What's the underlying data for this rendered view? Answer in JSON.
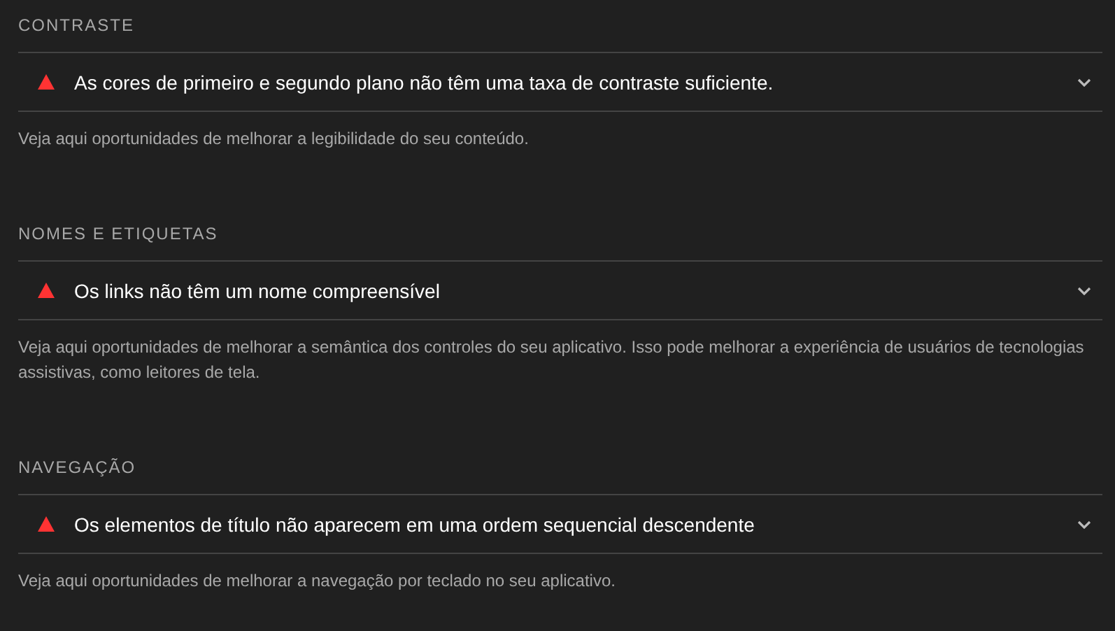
{
  "sections": [
    {
      "title": "CONTRASTE",
      "audit": {
        "text": "As cores de primeiro e segundo plano não têm uma taxa de contraste suficiente.",
        "expanded": false
      },
      "description": "Veja aqui oportunidades de melhorar a legibilidade do seu conteúdo."
    },
    {
      "title": "NOMES E ETIQUETAS",
      "audit": {
        "text": "Os links não têm um nome compreensível",
        "expanded": false
      },
      "description": "Veja aqui oportunidades de melhorar a semântica dos controles do seu aplicativo. Isso pode melhorar a experiência de usuários de tecnologias assistivas, como leitores de tela."
    },
    {
      "title": "NAVEGAÇÃO",
      "audit": {
        "text": "Os elementos de título não aparecem em uma ordem sequencial descendente",
        "expanded": false
      },
      "description": "Veja aqui oportunidades de melhorar a navegação por teclado no seu aplicativo."
    }
  ]
}
